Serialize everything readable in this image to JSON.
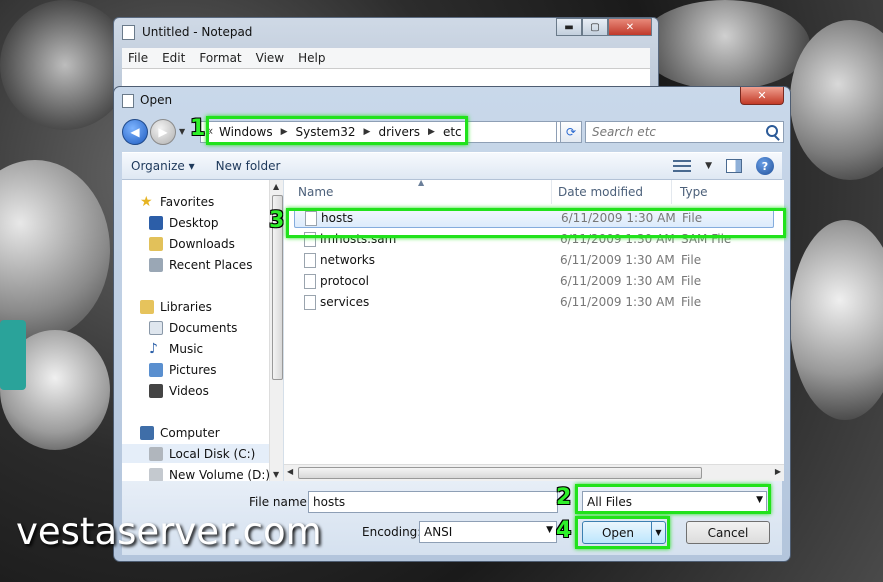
{
  "notepad": {
    "title": "Untitled - Notepad",
    "menu": [
      "File",
      "Edit",
      "Format",
      "View",
      "Help"
    ]
  },
  "dialog": {
    "title": "Open",
    "close_glyph": "✕",
    "address": {
      "overflow": "«",
      "crumbs": [
        "Windows",
        "System32",
        "drivers",
        "etc"
      ]
    },
    "search_placeholder": "Search etc",
    "toolbar": {
      "organize": "Organize ▾",
      "new_folder": "New folder"
    },
    "nav": {
      "favorites": "Favorites",
      "desktop": "Desktop",
      "downloads": "Downloads",
      "recent": "Recent Places",
      "libraries": "Libraries",
      "documents": "Documents",
      "music": "Music",
      "pictures": "Pictures",
      "videos": "Videos",
      "computer": "Computer",
      "local_disk": "Local Disk (C:)",
      "new_volume": "New Volume (D:)"
    },
    "columns": {
      "name": "Name",
      "date": "Date modified",
      "type": "Type"
    },
    "files": [
      {
        "name": "hosts",
        "date": "6/11/2009 1:30 AM",
        "type": "File"
      },
      {
        "name": "lmhosts.sam",
        "date": "6/11/2009 1:30 AM",
        "type": "SAM File"
      },
      {
        "name": "networks",
        "date": "6/11/2009 1:30 AM",
        "type": "File"
      },
      {
        "name": "protocol",
        "date": "6/11/2009 1:30 AM",
        "type": "File"
      },
      {
        "name": "services",
        "date": "6/11/2009 1:30 AM",
        "type": "File"
      }
    ],
    "filename_label": "File name:",
    "filename_value": "hosts",
    "filetype_value": "All Files",
    "encoding_label": "Encoding:",
    "encoding_value": "ANSI",
    "open_label": "Open",
    "cancel_label": "Cancel"
  },
  "annotations": [
    "1",
    "2",
    "3",
    "4"
  ],
  "watermark": "vestaserver.com",
  "colors": {
    "highlight": "#21e21b",
    "selection": "#dcebfc"
  }
}
